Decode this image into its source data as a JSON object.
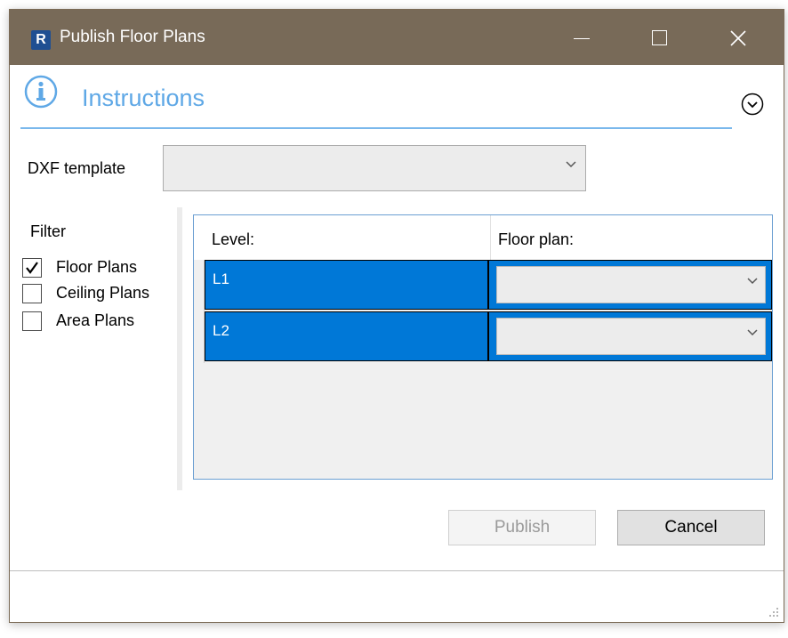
{
  "window": {
    "title": "Publish Floor Plans",
    "app_icon_letter": "R"
  },
  "instructions": {
    "label": "Instructions"
  },
  "dxf": {
    "label": "DXF template",
    "value": ""
  },
  "filter": {
    "label": "Filter",
    "options": [
      {
        "label": "Floor Plans",
        "checked": true
      },
      {
        "label": "Ceiling Plans",
        "checked": false
      },
      {
        "label": "Area Plans",
        "checked": false
      }
    ]
  },
  "grid": {
    "columns": [
      "Level:",
      "Floor plan:"
    ],
    "rows": [
      {
        "level": "L1",
        "floor_plan": ""
      },
      {
        "level": "L2",
        "floor_plan": ""
      }
    ]
  },
  "buttons": {
    "publish": "Publish",
    "cancel": "Cancel"
  },
  "colors": {
    "titlebar": "#786a58",
    "accent": "#5fa8e6",
    "selection": "#0078d7"
  }
}
